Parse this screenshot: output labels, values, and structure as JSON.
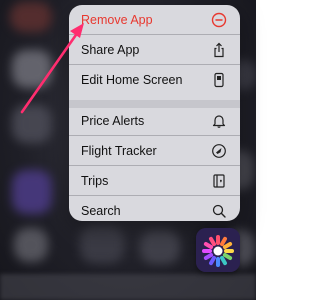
{
  "menu": {
    "items": [
      {
        "label": "Remove App",
        "icon": "minus-circle-icon",
        "color": "#e8382f"
      },
      {
        "label": "Share App",
        "icon": "share-icon"
      },
      {
        "label": "Edit Home Screen",
        "icon": "phone-edit-icon"
      },
      {
        "label": "Price Alerts",
        "icon": "bell-icon"
      },
      {
        "label": "Flight Tracker",
        "icon": "flight-tracker-icon"
      },
      {
        "label": "Trips",
        "icon": "trips-icon"
      },
      {
        "label": "Search",
        "icon": "search-icon"
      }
    ]
  },
  "annotation": {
    "color": "#ff2d6f",
    "icon": "pink-arrow-icon"
  },
  "app": {
    "icon": "colorful-sunburst-app-icon"
  }
}
